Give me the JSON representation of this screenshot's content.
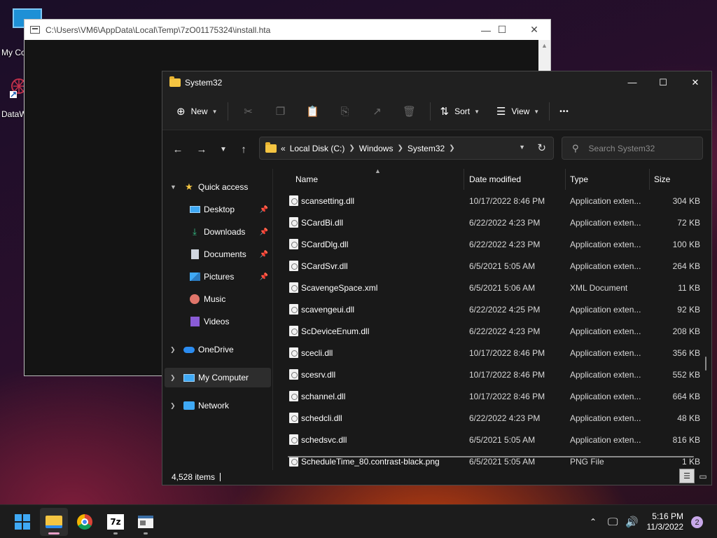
{
  "desktop": {
    "icons": [
      {
        "label": "My Co",
        "icon": "monitor-icon"
      },
      {
        "label": "DataW",
        "icon": "datawrapper-shortcut-icon"
      }
    ]
  },
  "hta_window": {
    "title": "C:\\Users\\VM6\\AppData\\Local\\Temp\\7zO01175324\\install.hta",
    "controls": {
      "minimize": "—",
      "maximize": "☐",
      "close": "✕"
    }
  },
  "explorer": {
    "title": "System32",
    "window_controls": {
      "minimize": "—",
      "maximize": "☐",
      "close": "✕"
    },
    "toolbar": {
      "new_label": "New",
      "sort_label": "Sort",
      "view_label": "View",
      "more_label": "•••"
    },
    "address": {
      "overflow": "«",
      "segments": [
        "Local Disk (C:)",
        "Windows",
        "System32"
      ]
    },
    "search": {
      "placeholder": "Search System32"
    },
    "nav": {
      "quick_access": "Quick access",
      "desktop": "Desktop",
      "downloads": "Downloads",
      "documents": "Documents",
      "pictures": "Pictures",
      "music": "Music",
      "videos": "Videos",
      "onedrive": "OneDrive",
      "my_computer": "My Computer",
      "network": "Network"
    },
    "columns": {
      "name": "Name",
      "date": "Date modified",
      "type": "Type",
      "size": "Size"
    },
    "files": [
      {
        "name": "scansetting.dll",
        "date": "10/17/2022 8:46 PM",
        "type": "Application exten...",
        "size": "304 KB"
      },
      {
        "name": "SCardBi.dll",
        "date": "6/22/2022 4:23 PM",
        "type": "Application exten...",
        "size": "72 KB"
      },
      {
        "name": "SCardDlg.dll",
        "date": "6/22/2022 4:23 PM",
        "type": "Application exten...",
        "size": "100 KB"
      },
      {
        "name": "SCardSvr.dll",
        "date": "6/5/2021 5:05 AM",
        "type": "Application exten...",
        "size": "264 KB"
      },
      {
        "name": "ScavengeSpace.xml",
        "date": "6/5/2021 5:06 AM",
        "type": "XML Document",
        "size": "11 KB"
      },
      {
        "name": "scavengeui.dll",
        "date": "6/22/2022 4:25 PM",
        "type": "Application exten...",
        "size": "92 KB"
      },
      {
        "name": "ScDeviceEnum.dll",
        "date": "6/22/2022 4:23 PM",
        "type": "Application exten...",
        "size": "208 KB"
      },
      {
        "name": "scecli.dll",
        "date": "10/17/2022 8:46 PM",
        "type": "Application exten...",
        "size": "356 KB"
      },
      {
        "name": "scesrv.dll",
        "date": "10/17/2022 8:46 PM",
        "type": "Application exten...",
        "size": "552 KB"
      },
      {
        "name": "schannel.dll",
        "date": "10/17/2022 8:46 PM",
        "type": "Application exten...",
        "size": "664 KB"
      },
      {
        "name": "schedcli.dll",
        "date": "6/22/2022 4:23 PM",
        "type": "Application exten...",
        "size": "48 KB"
      },
      {
        "name": "schedsvc.dll",
        "date": "6/5/2021 5:05 AM",
        "type": "Application exten...",
        "size": "816 KB"
      },
      {
        "name": "ScheduleTime_80.contrast-black.png",
        "date": "6/5/2021 5:05 AM",
        "type": "PNG File",
        "size": "1 KB"
      }
    ],
    "status": {
      "item_count": "4,528 items"
    }
  },
  "taskbar": {
    "time": "5:16 PM",
    "date": "11/3/2022",
    "notification_count": "2",
    "sevenzip_label": "7z"
  },
  "colors": {
    "accent": "#3fa9f5",
    "folder": "#f5c542",
    "window_bg": "#191919"
  }
}
